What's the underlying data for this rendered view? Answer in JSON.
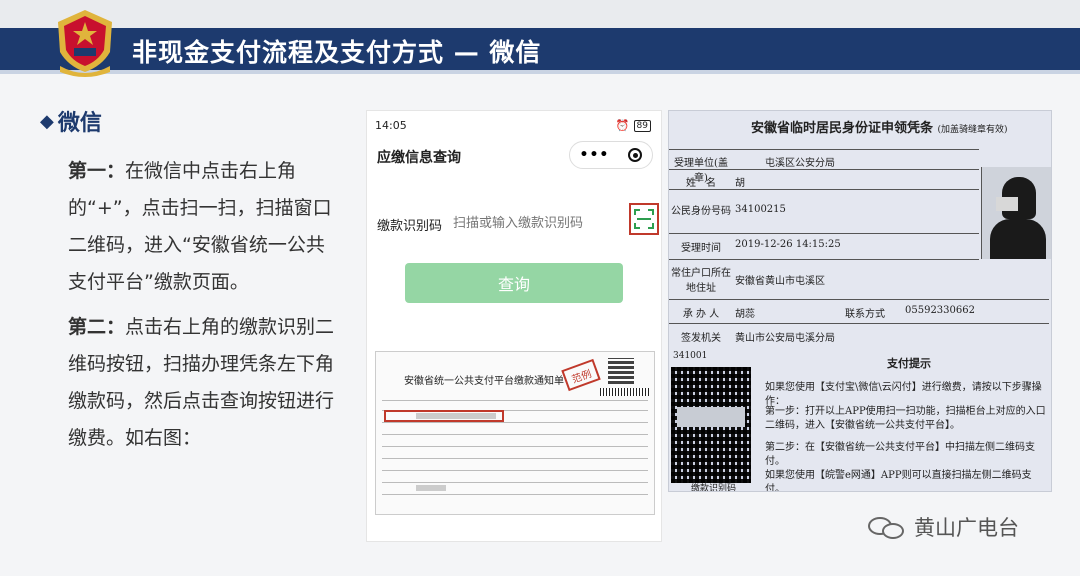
{
  "header": {
    "title": "非现金支付流程及支付方式 — 微信",
    "colors": {
      "bar": "#1d3a6e",
      "emblem_red": "#c8102e",
      "emblem_gold": "#e0b43c"
    }
  },
  "left": {
    "section_title": "微信",
    "step1_label": "第一：",
    "step1_text": "在微信中点击右上角的“+”，点击扫一扫，扫描窗口二维码，进入“安徽省统一公共支付平台”缴款页面。",
    "step2_label": "第二：",
    "step2_text": "点击右上角的缴款识别二维码按钮，扫描办理凭条左下角缴款码，然后点击查询按钮进行缴费。如右图："
  },
  "phone": {
    "time": "14:05",
    "battery": "89",
    "page_title": "应缴信息查询",
    "field_label": "缴款识别码",
    "field_placeholder": "扫描或输入缴款识别码",
    "query_button": "查询",
    "notice_title": "安徽省统一公共支付平台缴款通知单",
    "stamp": "范例",
    "accent_color": "#95d6a4"
  },
  "voucher": {
    "title": "安徽省临时居民身份证申领凭条",
    "title_note": "(加盖骑缝章有效)",
    "rows": [
      {
        "label": "受理单位(盖章)",
        "value": "屯溪区公安分局"
      },
      {
        "label": "姓　名",
        "value": "胡"
      },
      {
        "label": "公民身份号码",
        "value": "34100215"
      },
      {
        "label": "受理时间",
        "value": "2019-12-26 14:15:25"
      },
      {
        "label": "常住户口所在地住址",
        "value": "安徽省黄山市屯溪区"
      },
      {
        "label": "承 办 人",
        "value": "胡蕊"
      },
      {
        "label": "签发机关",
        "value": "黄山市公安局屯溪分局"
      }
    ],
    "contact_label": "联系方式",
    "contact_value": "05592330662",
    "id_prefix": "341001",
    "tips_title": "支付提示",
    "tip_1": "如果您使用【支付宝\\微信\\云闪付】进行缴费，请按以下步骤操作：",
    "tip_2": "第一步：打开以上APP使用扫一扫功能，扫描柜台上对应的入口二维码，进入【安徽省统一公共支付平台】。",
    "tip_3": "第二步：在【安徽省统一公共支付平台】中扫描左侧二维码支付。",
    "tip_4": "如果您使用【皖警e网通】APP则可以直接扫描左侧二维码支付。",
    "qr_label": "缴款识别码"
  },
  "watermark": {
    "text": "黄山广电台"
  }
}
